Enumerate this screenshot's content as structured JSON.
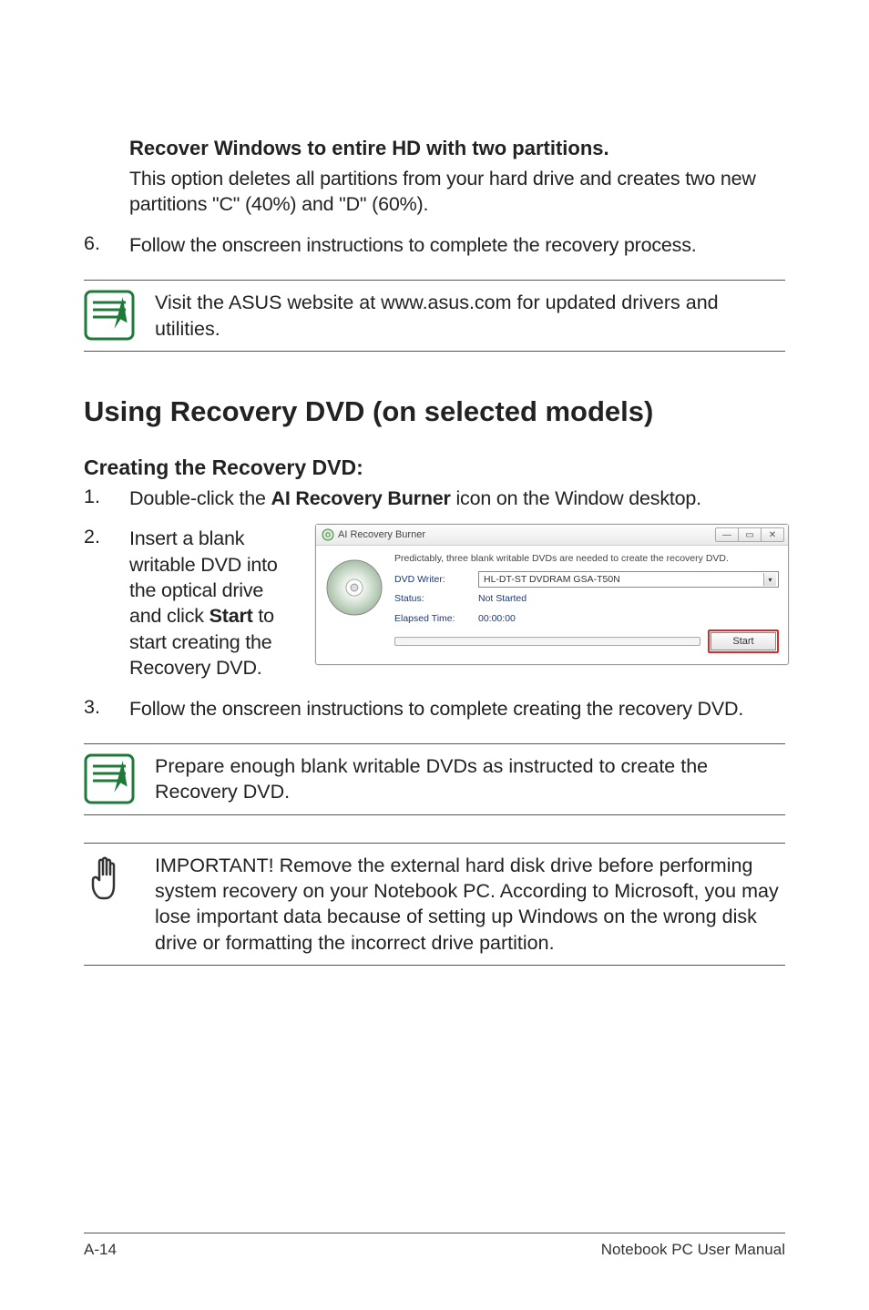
{
  "recover": {
    "title": "Recover Windows to entire HD with two partitions.",
    "desc": "This option deletes all partitions from your hard drive and creates two new partitions \"C\" (40%) and \"D\" (60%)."
  },
  "step6": {
    "num": "6.",
    "text": "Follow the onscreen instructions to complete the recovery process."
  },
  "note1": "Visit the ASUS website at www.asus.com for updated drivers and utilities.",
  "heading": "Using Recovery DVD (on selected models)",
  "subheading": "Creating the Recovery DVD:",
  "step1": {
    "num": "1.",
    "pre": "Double-click the ",
    "bold": "AI Recovery Burner",
    "post": " icon on the Window desktop."
  },
  "step2": {
    "num": "2.",
    "pre": "Insert a blank writable DVD into the optical drive and click ",
    "bold": "Start",
    "post": " to start creating the Recovery DVD."
  },
  "burner": {
    "title": "AI Recovery Burner",
    "note": "Predictably, three blank writable DVDs are needed to create the recovery DVD.",
    "writer_label": "DVD Writer:",
    "writer_value": "HL-DT-ST DVDRAM GSA-T50N",
    "status_label": "Status:",
    "status_value": "Not Started",
    "elapsed_label": "Elapsed Time:",
    "elapsed_value": "00:00:00",
    "start": "Start"
  },
  "step3": {
    "num": "3.",
    "text": "Follow the onscreen instructions to complete creating the recovery DVD."
  },
  "note2": "Prepare enough blank writable DVDs as instructed to create the Recovery DVD.",
  "note3": "IMPORTANT! Remove the external hard disk drive before performing system recovery on your Notebook PC. According to Microsoft, you may lose important data because of setting up Windows on the wrong disk drive or formatting the incorrect drive partition.",
  "footer": {
    "left": "A-14",
    "right": "Notebook PC User Manual"
  }
}
